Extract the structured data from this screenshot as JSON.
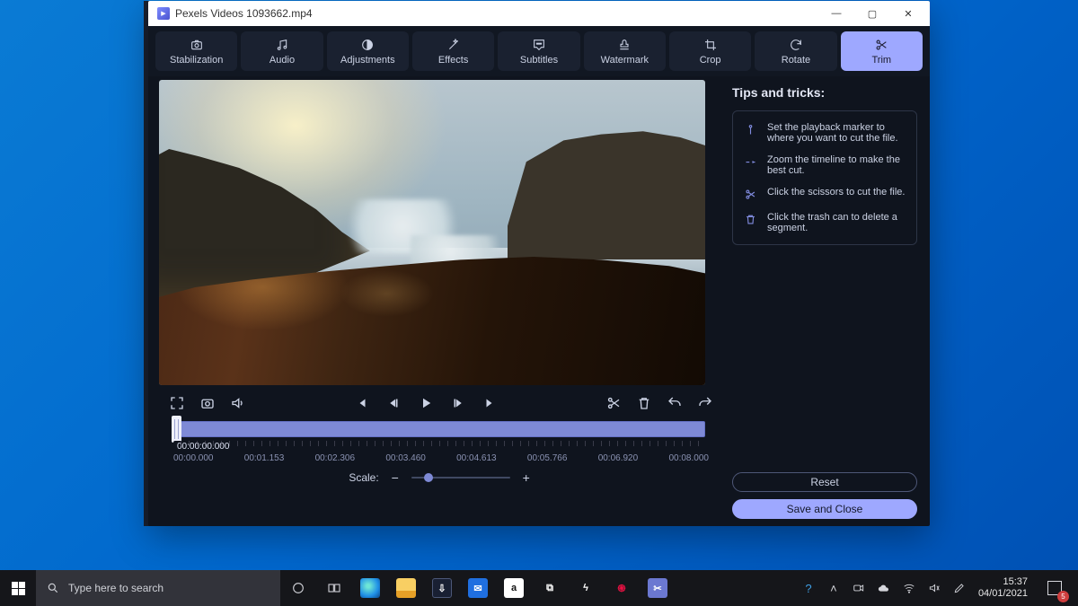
{
  "window": {
    "title": "Pexels Videos 1093662.mp4",
    "controls": {
      "min": "—",
      "max": "▢",
      "close": "✕"
    }
  },
  "tabs": [
    {
      "id": "stabilization",
      "label": "Stabilization"
    },
    {
      "id": "audio",
      "label": "Audio"
    },
    {
      "id": "adjustments",
      "label": "Adjustments"
    },
    {
      "id": "effects",
      "label": "Effects"
    },
    {
      "id": "subtitles",
      "label": "Subtitles"
    },
    {
      "id": "watermark",
      "label": "Watermark"
    },
    {
      "id": "crop",
      "label": "Crop"
    },
    {
      "id": "rotate",
      "label": "Rotate"
    },
    {
      "id": "trim",
      "label": "Trim",
      "active": true
    }
  ],
  "tips": {
    "title": "Tips and tricks:",
    "items": [
      "Set the playback marker to where you want to cut the file.",
      "Zoom the timeline to make the best cut.",
      "Click the scissors to cut the file.",
      "Click the trash can to delete a segment."
    ]
  },
  "buttons": {
    "reset": "Reset",
    "save": "Save and Close"
  },
  "timeline": {
    "current": "00:00:00.000",
    "ticks": [
      "00:00.000",
      "00:01.153",
      "00:02.306",
      "00:03.460",
      "00:04.613",
      "00:05.766",
      "00:06.920",
      "00:08.000"
    ],
    "scale_label": "Scale:"
  },
  "taskbar": {
    "search_placeholder": "Type here to search",
    "clock_time": "15:37",
    "clock_date": "04/01/2021",
    "notif_count": "5"
  },
  "colors": {
    "accent": "#9ea8ff",
    "panel": "#1a2130",
    "bg": "#0f141e"
  }
}
